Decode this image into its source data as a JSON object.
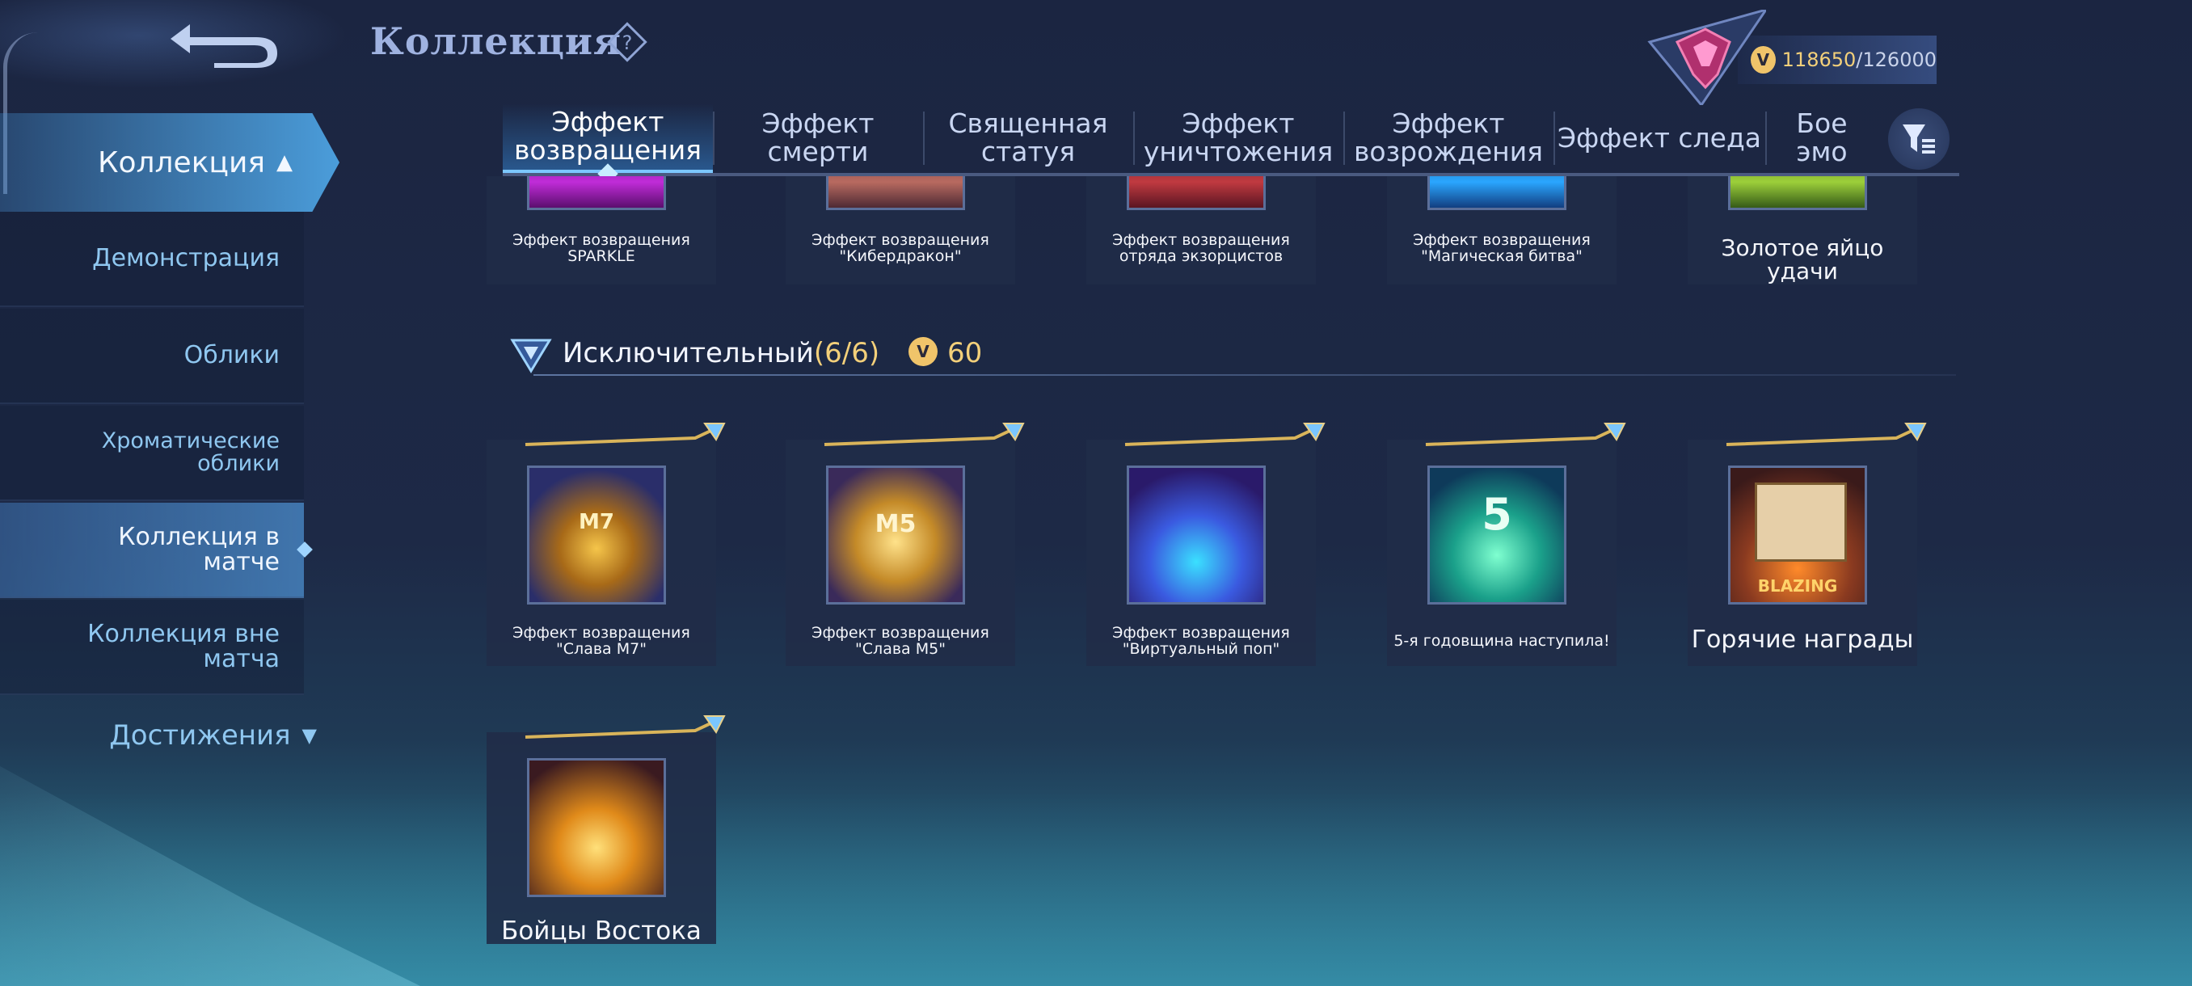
{
  "header": {
    "title": "Коллекция",
    "help_icon": "help-icon",
    "back_icon": "back-arrow-icon"
  },
  "currency": {
    "value": "118650",
    "max": "/126000",
    "coin_glyph": "V",
    "icon": "collection-coin-icon"
  },
  "sidebar": {
    "collection_label": "Коллекция",
    "items": [
      {
        "label": "Демонстрация"
      },
      {
        "label": "Облики"
      },
      {
        "label": "Хроматические облики"
      },
      {
        "label": "Коллекция в матче"
      },
      {
        "label": "Коллекция вне матча"
      }
    ],
    "achievements_label": "Достижения"
  },
  "tabs": [
    {
      "label": "Эффект возвращения"
    },
    {
      "label": "Эффект смерти"
    },
    {
      "label": "Священная статуя"
    },
    {
      "label": "Эффект уничтожения"
    },
    {
      "label": "Эффект возрождения"
    },
    {
      "label": "Эффект следа"
    },
    {
      "label": "Бое эмо"
    }
  ],
  "top_row": [
    {
      "label": "Эффект возвращения SPARKLE"
    },
    {
      "label": "Эффект возвращения \"Кибердракон\""
    },
    {
      "label": "Эффект возвращения отряда экзорцистов"
    },
    {
      "label": "Эффект возвращения \"Магическая битва\""
    },
    {
      "label": "Золотое яйцо удачи"
    }
  ],
  "section": {
    "title": "Исключительный",
    "count": "(6/6)",
    "points": "60",
    "coin_glyph": "V"
  },
  "items": [
    {
      "label": "Эффект возвращения \"Слава M7\"",
      "img_text": "M7"
    },
    {
      "label": "Эффект возвращения \"Слава M5\"",
      "img_text": "M5"
    },
    {
      "label": "Эффект возвращения \"Виртуальный поп\""
    },
    {
      "label": "5-я годовщина наступила!",
      "img_text": "5"
    },
    {
      "label": "Горячие награды",
      "img_text": "BLAZING"
    },
    {
      "label": "Бойцы Востока"
    }
  ],
  "colors": {
    "accent": "#7cc7ff",
    "gold": "#f3d07a",
    "background": "#1b2541"
  }
}
